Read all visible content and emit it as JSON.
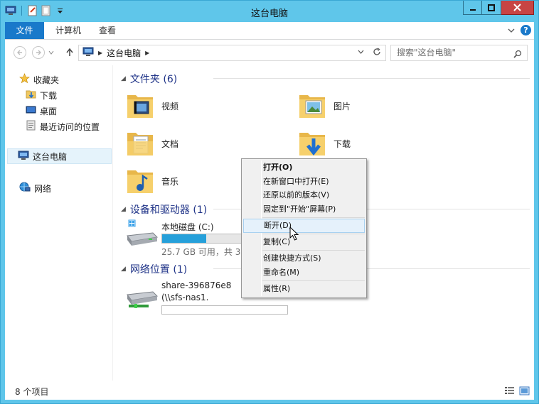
{
  "window": {
    "title": "这台电脑"
  },
  "ribbon": {
    "tabs": [
      "文件",
      "计算机",
      "查看"
    ]
  },
  "address": {
    "crumb": "这台电脑",
    "search_placeholder": "搜索\"这台电脑\""
  },
  "nav": {
    "favorites": "收藏夹",
    "fav_items": [
      "下载",
      "桌面",
      "最近访问的位置"
    ],
    "this_pc": "这台电脑",
    "network": "网络"
  },
  "groups": {
    "folders": "文件夹 (6)",
    "devices": "设备和驱动器 (1)",
    "network": "网络位置 (1)"
  },
  "folders": [
    "视频",
    "图片",
    "文档",
    "下载",
    "音乐"
  ],
  "drive": {
    "name": "本地磁盘 (C:)",
    "info": "25.7 GB 可用，共 39.",
    "used_fraction": 0.35
  },
  "netloc": {
    "name": "share-396876e8",
    "path": "(\\\\sfs-nas1."
  },
  "context_menu": {
    "items": [
      "打开(O)",
      "在新窗口中打开(E)",
      "还原以前的版本(V)",
      "固定到\"开始\"屏幕(P)",
      "断开(D)",
      "复制(C)",
      "创建快捷方式(S)",
      "重命名(M)",
      "属性(R)"
    ]
  },
  "status": {
    "count": "8 个项目"
  },
  "colors": {
    "accent": "#1979ca",
    "title_bar": "#5fc6ea",
    "close": "#c74444",
    "drive_fill": "#26a0da"
  }
}
